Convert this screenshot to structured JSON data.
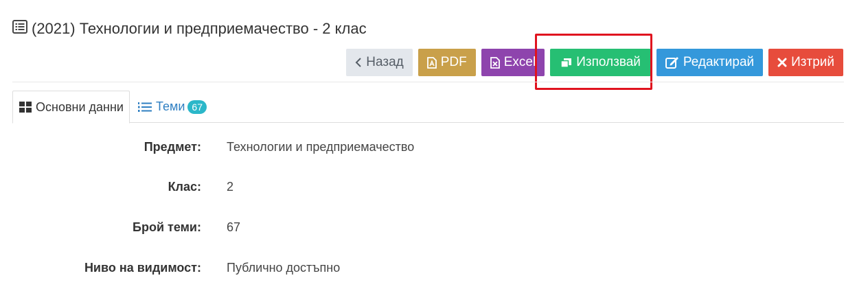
{
  "title": "(2021) Технологии и предприемачество - 2 клас",
  "toolbar": {
    "back_label": "Назад",
    "pdf_label": "PDF",
    "excel_label": "Excel",
    "use_label": "Използвай",
    "edit_label": "Редактирай",
    "delete_label": "Изтрий"
  },
  "tabs": {
    "main_label": "Основни данни",
    "topics_label": "Теми",
    "topics_count": "67"
  },
  "details": [
    {
      "label": "Предмет:",
      "value": "Технологии и предприемачество"
    },
    {
      "label": "Клас:",
      "value": "2"
    },
    {
      "label": "Брой теми:",
      "value": "67"
    },
    {
      "label": "Ниво на видимост:",
      "value": "Публично достъпно"
    }
  ],
  "colors": {
    "use_button": "#26bf73",
    "highlight": "#e0131f",
    "badge": "#2bb7c9"
  }
}
